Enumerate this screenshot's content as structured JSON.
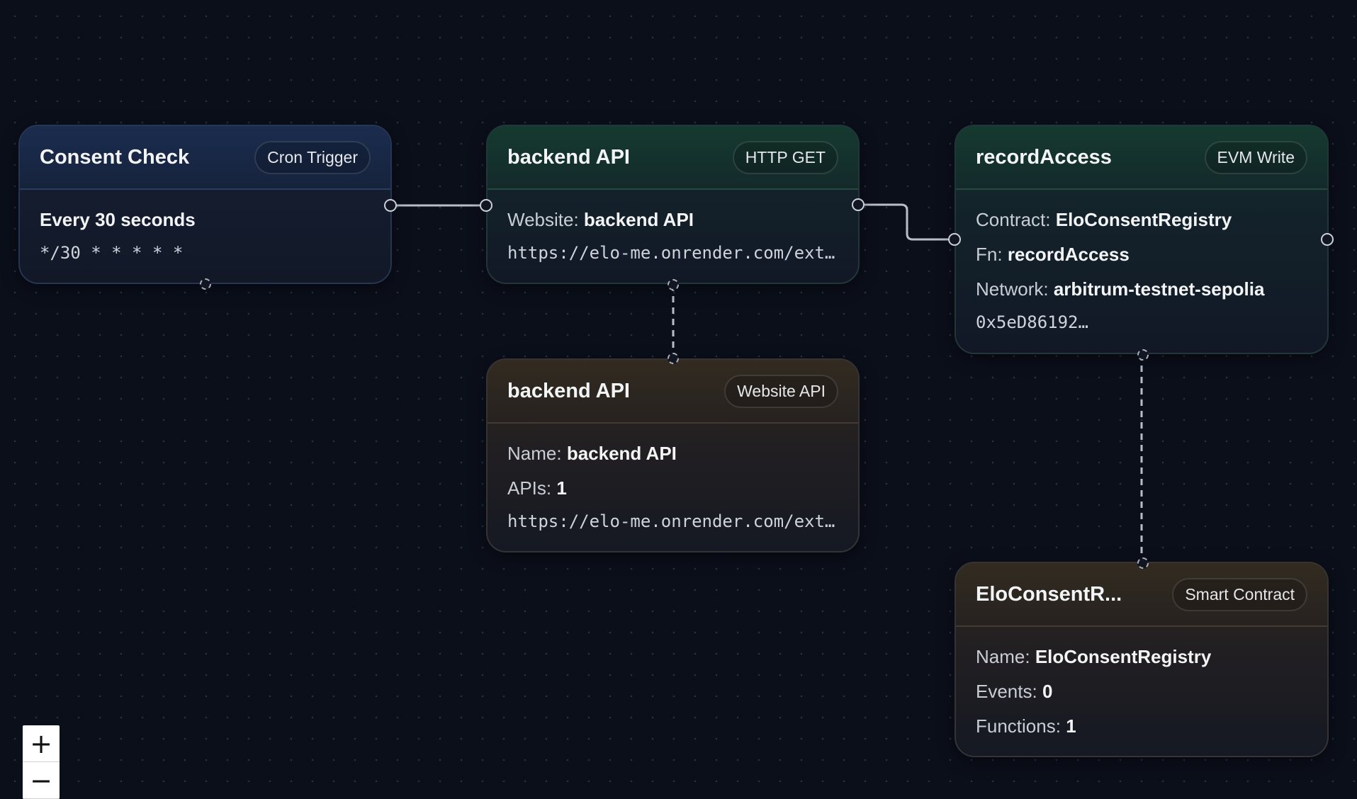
{
  "nodes": {
    "consent_check": {
      "title": "Consent Check",
      "badge": "Cron Trigger",
      "schedule": "Every 30 seconds",
      "cron": "*/30 * * * * *"
    },
    "backend_api_http": {
      "title": "backend API",
      "badge": "HTTP GET",
      "website_label": "Website:",
      "website_value": "backend API",
      "url": "https://elo-me.onrender.com/ext…"
    },
    "record_access": {
      "title": "recordAccess",
      "badge": "EVM Write",
      "contract_label": "Contract:",
      "contract_value": "EloConsentRegistry",
      "fn_label": "Fn:",
      "fn_value": "recordAccess",
      "network_label": "Network:",
      "network_value": "arbitrum-testnet-sepolia",
      "address": "0x5eD86192…"
    },
    "backend_api_website": {
      "title": "backend API",
      "badge": "Website API",
      "name_label": "Name:",
      "name_value": "backend API",
      "apis_label": "APIs:",
      "apis_value": "1",
      "url": "https://elo-me.onrender.com/ext…"
    },
    "elo_contract": {
      "title": "EloConsentR...",
      "badge": "Smart Contract",
      "name_label": "Name:",
      "name_value": "EloConsentRegistry",
      "events_label": "Events:",
      "events_value": "0",
      "functions_label": "Functions:",
      "functions_value": "1"
    }
  },
  "zoom_controls": {
    "zoom_in": "+",
    "zoom_out": "−"
  },
  "colors": {
    "background": "#0b0f1a",
    "edge": "#b8bec8"
  }
}
